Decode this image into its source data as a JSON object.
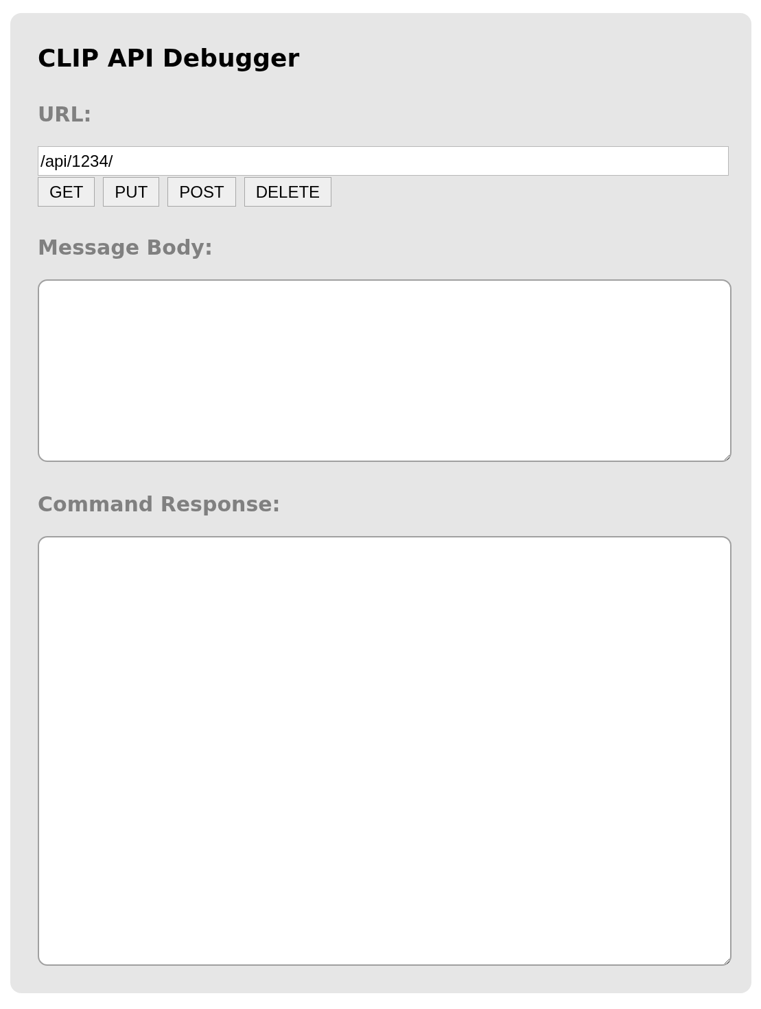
{
  "title": "CLIP API Debugger",
  "url": {
    "label": "URL:",
    "value": "/api/1234/"
  },
  "methods": [
    "GET",
    "PUT",
    "POST",
    "DELETE"
  ],
  "message_body": {
    "label": "Message Body:"
  },
  "command_response": {
    "label": "Command Response:"
  }
}
